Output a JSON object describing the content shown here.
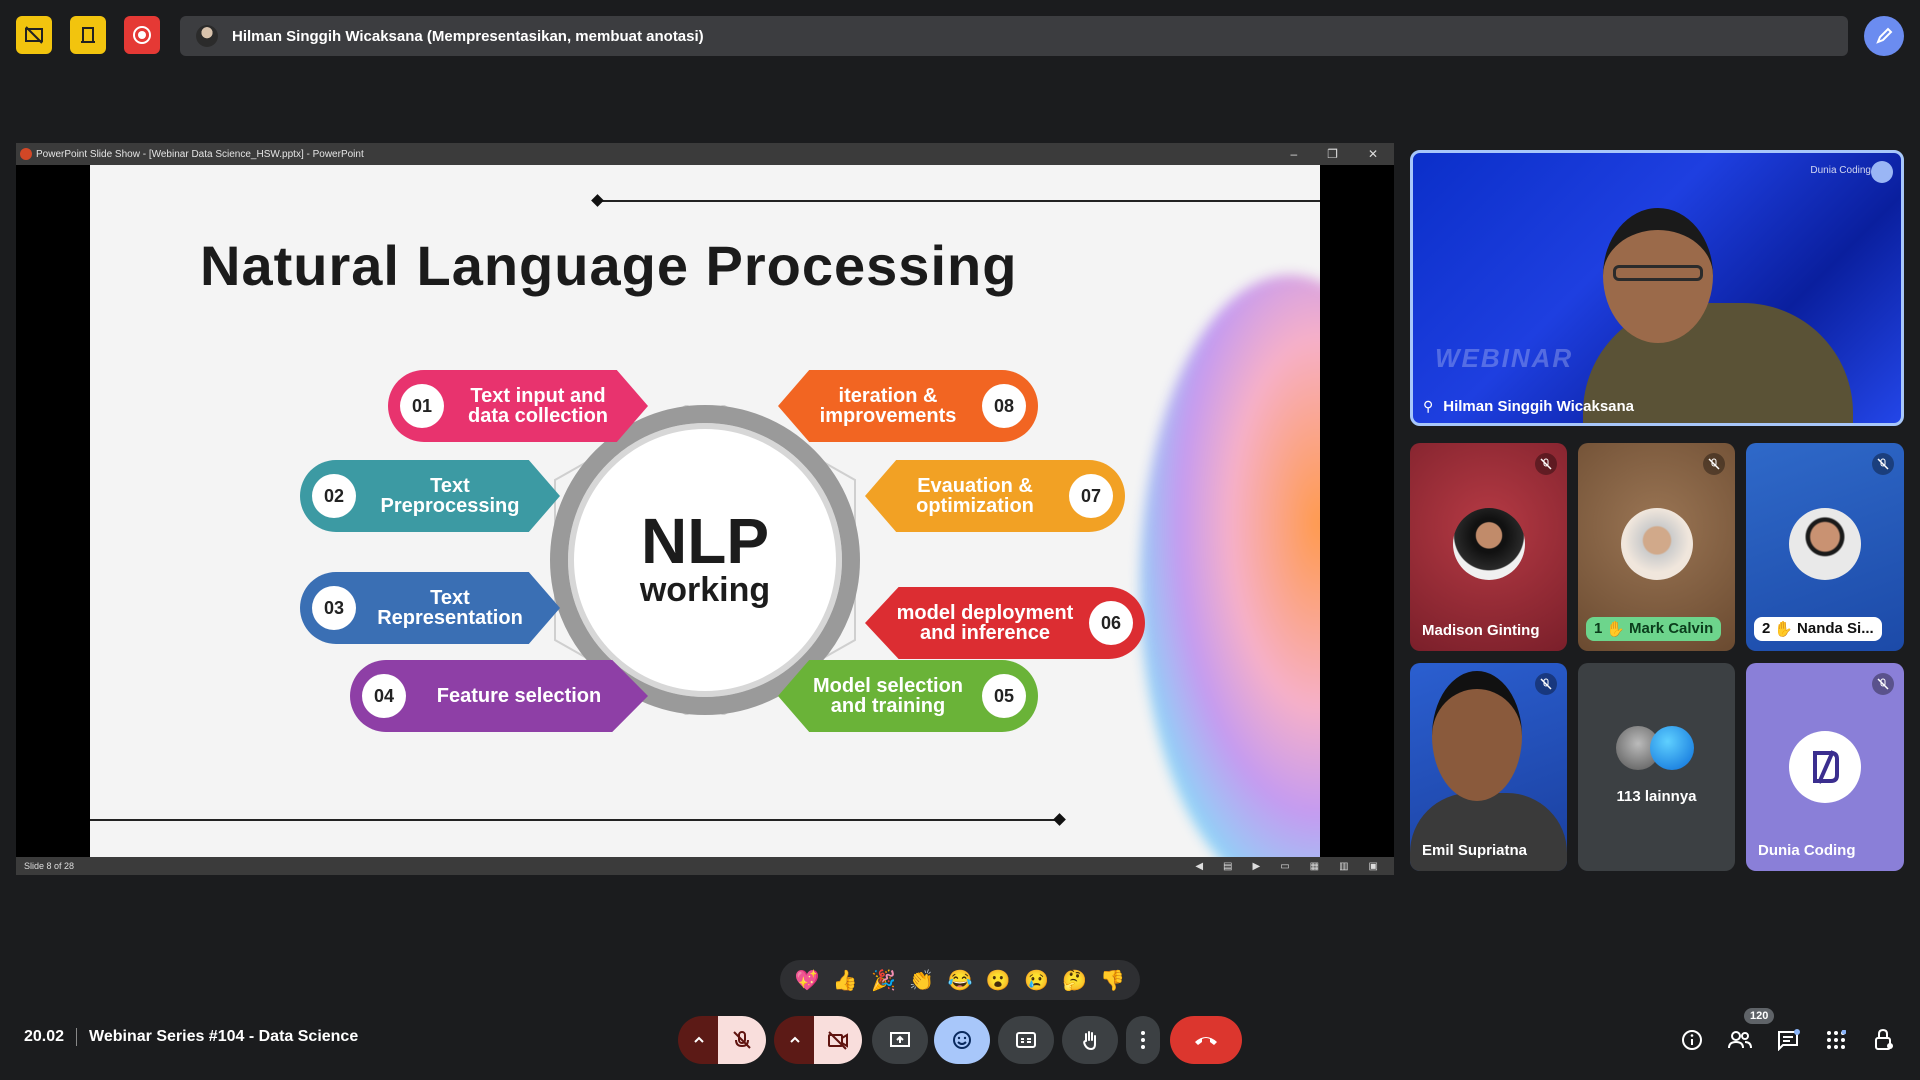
{
  "presenter_bar": {
    "text": "Hilman Singgih Wicaksana (Mempresentasikan, membuat anotasi)"
  },
  "ppt": {
    "window_title": "PowerPoint Slide Show - [Webinar Data Science_HSW.pptx] - PowerPoint",
    "status": "Slide 8 of 28",
    "slide": {
      "title": "Natural Language Processing",
      "center_big": "NLP",
      "center_small": "working",
      "steps": [
        {
          "num": "01",
          "label": "Text input and data collection",
          "color": "#e8336e"
        },
        {
          "num": "02",
          "label": "Text Preprocessing",
          "color": "#3c9aa3"
        },
        {
          "num": "03",
          "label": "Text Representation",
          "color": "#3a6fb4"
        },
        {
          "num": "04",
          "label": "Feature selection",
          "color": "#8e3fa6"
        },
        {
          "num": "05",
          "label": "Model selection and training",
          "color": "#6ab338"
        },
        {
          "num": "06",
          "label": "model deployment and inference",
          "color": "#dc2d32"
        },
        {
          "num": "07",
          "label": "Evauation & optimization",
          "color": "#f2a124"
        },
        {
          "num": "08",
          "label": "iteration & improvements",
          "color": "#f26522"
        }
      ]
    }
  },
  "main_tile": {
    "name": "Hilman Singgih Wicaksana",
    "brand": "Dunia Coding",
    "bg_text": "WEBINAR"
  },
  "participants": [
    {
      "name": "Madison Ginting"
    },
    {
      "name": "Mark Calvin",
      "hand": "1"
    },
    {
      "name": "Nanda Si...",
      "hand": "2"
    },
    {
      "name": "Emil Supriatna"
    },
    {
      "name": "113 lainnya"
    },
    {
      "name": "Dunia Coding"
    }
  ],
  "emojis": [
    "💖",
    "👍",
    "🎉",
    "👏",
    "😂",
    "😮",
    "😢",
    "🤔",
    "👎"
  ],
  "meeting": {
    "time": "20.02",
    "title": "Webinar Series #104 - Data Science"
  },
  "people_count": "120",
  "colors": {
    "end_call": "#dc362e",
    "mic_off": "#f9dedc",
    "emoji_active": "#a8c7fa"
  }
}
